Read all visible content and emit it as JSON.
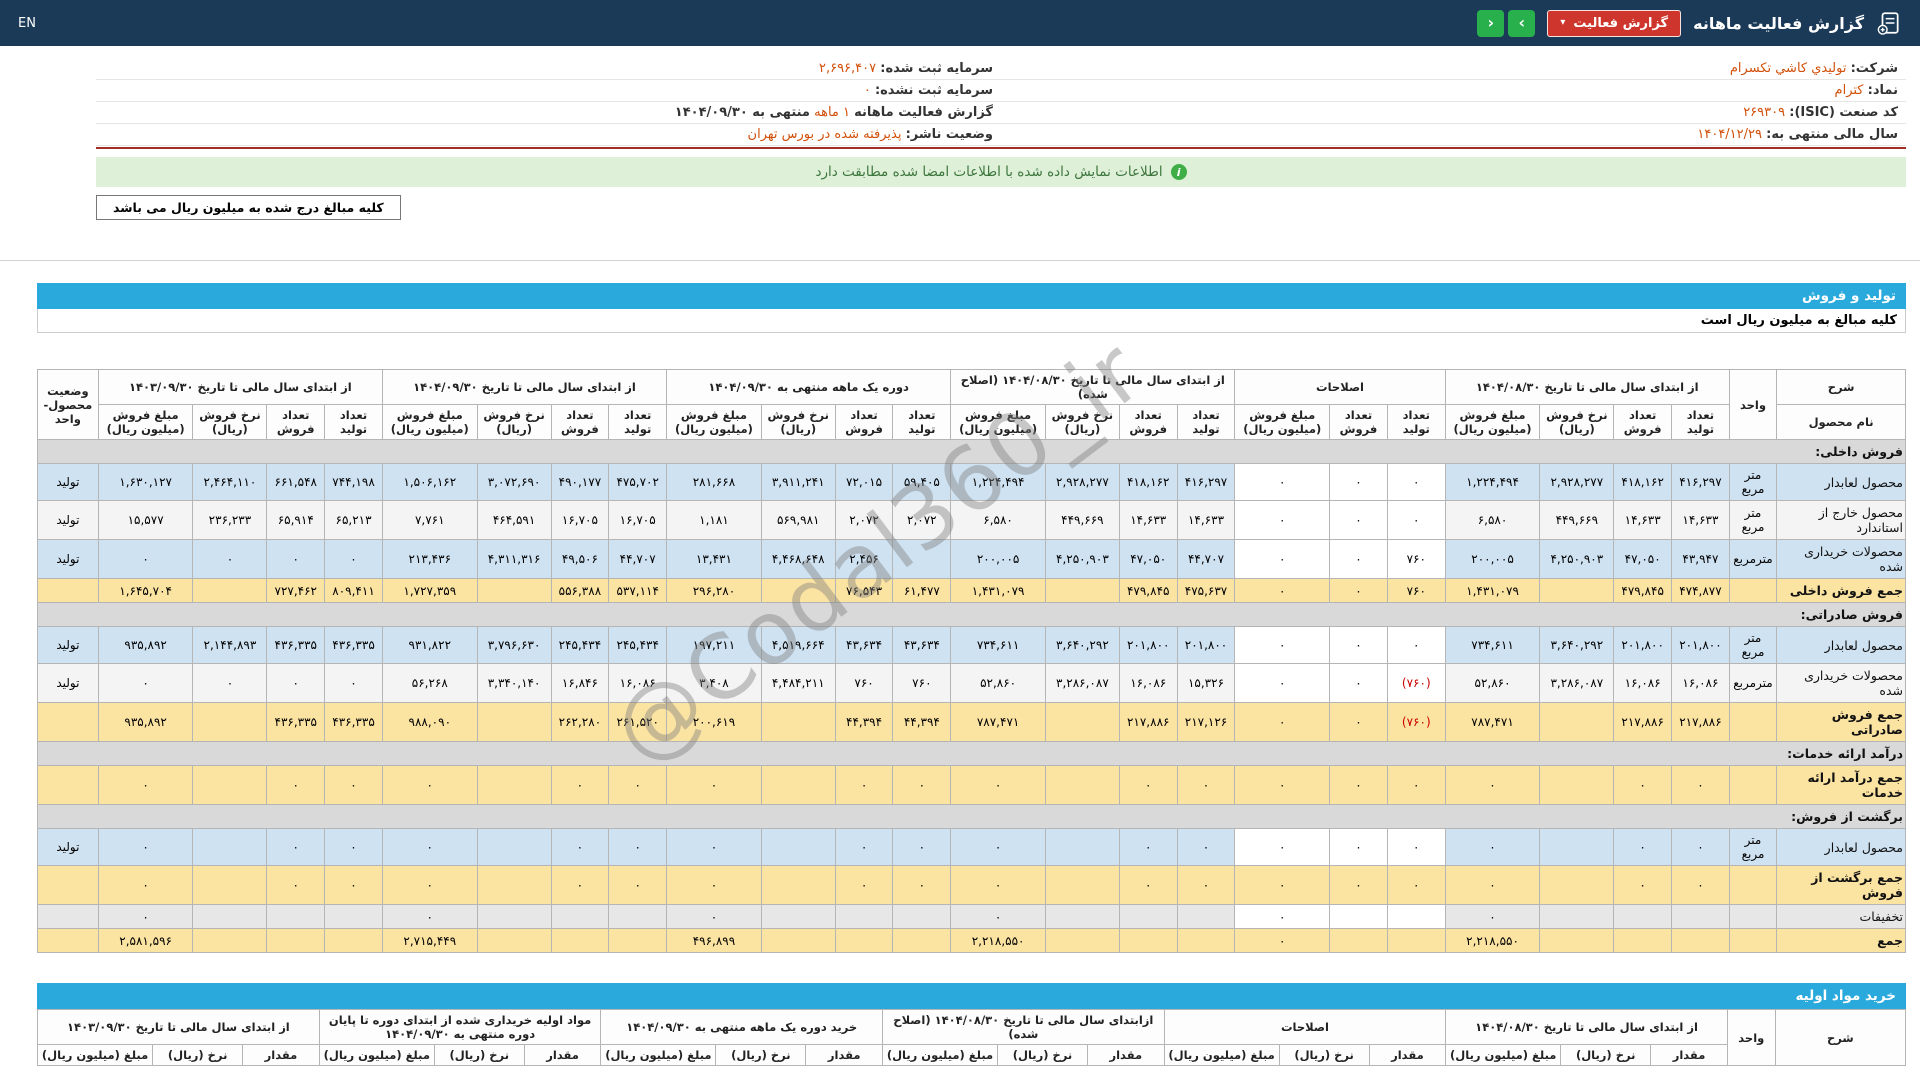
{
  "page": {
    "watermark": "@Codal360_ir",
    "colors": {
      "header_bar": "#1b3a57",
      "accent": "#d2500a",
      "section_bar": "#29a9dc",
      "notice_bg": "#dff0d8",
      "notice_text": "#3c763d",
      "row_blue": "#cfe2f2",
      "row_white": "#f4f4f4",
      "row_gray": "#e7e7e7",
      "row_total": "#fbe3a2",
      "row_section": "#d9d9d9",
      "btn_red": "#ce352c",
      "btn_green": "#28b04c",
      "neg": "#cc0000"
    }
  },
  "header": {
    "title": "گزارش فعالیت ماهانه",
    "report_button_label": "گزارش فعالیت",
    "caret_glyph": "▾",
    "nav_next_glyph": "›",
    "nav_prev_glyph": "‹",
    "lang_label": "EN"
  },
  "info_table": {
    "rows": [
      {
        "right_label": "شرکت:",
        "right_value": "توليدي كاشي تكسرام",
        "right_link": true,
        "left_label": "سرمایه ثبت شده:",
        "left_value": "۲,۶۹۶,۴۰۷",
        "left_suffix": "",
        "left_link": false
      },
      {
        "right_label": "نماد:",
        "right_value": "كترام",
        "right_link": true,
        "left_label": "سرمایه ثبت نشده:",
        "left_value": "۰",
        "left_suffix": "",
        "left_link": false
      },
      {
        "right_label": "کد صنعت (ISIC):",
        "right_value": "۲۶۹۳۰۹",
        "right_link": false,
        "left_label": "گزارش فعالیت ماهانه",
        "left_value": "۱ ماهه",
        "left_suffix": "منتهی به ۱۴۰۴/۰۹/۳۰",
        "left_link": false
      },
      {
        "right_label": "سال مالی منتهی به:",
        "right_value": "۱۴۰۴/۱۲/۲۹",
        "right_link": false,
        "left_label": "وضعیت ناشر:",
        "left_value": "پذيرفته شده در بورس تهران",
        "left_suffix": "",
        "left_link": false
      }
    ]
  },
  "notice": {
    "icon": "i",
    "text": "اطلاعات نمایش داده شده با اطلاعات امضا شده مطابقت دارد"
  },
  "unit_tab": {
    "text": "کلیه مبالغ درج شده به میلیون ریال می باشد"
  },
  "sales_section": {
    "bar_title": "تولید و فروش",
    "note": "کلیه مبالغ به میلیون ریال است"
  },
  "sales_table": {
    "desc_header": "شرح",
    "name_header": "نام محصول",
    "unit_header": "واحد",
    "status_header": "وضعیت محصول-واحد",
    "groups": [
      {
        "label": "از ابتدای سال مالی تا تاریخ ۱۴۰۴/۰۸/۳۰",
        "cols": [
          "تعداد تولید",
          "تعداد فروش",
          "نرخ فروش (ریال)",
          "مبلغ فروش (میلیون ریال)"
        ]
      },
      {
        "label": "اصلاحات",
        "cols": [
          "تعداد تولید",
          "تعداد فروش",
          "مبلغ فروش (میلیون ریال)"
        ]
      },
      {
        "label": "از ابتدای سال مالی تا تاریخ ۱۴۰۴/۰۸/۳۰ (اصلاح شده)",
        "cols": [
          "تعداد تولید",
          "تعداد فروش",
          "نرخ فروش (ریال)",
          "مبلغ فروش (میلیون ریال)"
        ]
      },
      {
        "label": "دوره یک ماهه منتهی به ۱۴۰۴/۰۹/۳۰",
        "cols": [
          "تعداد تولید",
          "تعداد فروش",
          "نرخ فروش (ریال)",
          "مبلغ فروش (میلیون ریال)"
        ]
      },
      {
        "label": "از ابتدای سال مالی تا تاریخ ۱۴۰۴/۰۹/۳۰",
        "cols": [
          "تعداد تولید",
          "تعداد فروش",
          "نرخ فروش (ریال)",
          "مبلغ فروش (میلیون ریال)"
        ]
      },
      {
        "label": "از ابتدای سال مالی تا تاریخ ۱۴۰۳/۰۹/۳۰",
        "cols": [
          "تعداد تولید",
          "تعداد فروش",
          "نرخ فروش (ریال)",
          "مبلغ فروش (میلیون ریال)"
        ]
      }
    ],
    "rows": [
      {
        "type": "section",
        "label": "فروش داخلی:"
      },
      {
        "type": "data",
        "shade": "blue",
        "name": "محصول لعابدار",
        "unit": "متر مربع",
        "status": "تولید",
        "values": [
          "۴۱۶,۲۹۷",
          "۴۱۸,۱۶۲",
          "۲,۹۲۸,۲۷۷",
          "۱,۲۲۴,۴۹۴",
          "۰",
          "۰",
          "۰",
          "۴۱۶,۲۹۷",
          "۴۱۸,۱۶۲",
          "۲,۹۲۸,۲۷۷",
          "۱,۲۲۴,۴۹۴",
          "۵۹,۴۰۵",
          "۷۲,۰۱۵",
          "۳,۹۱۱,۲۴۱",
          "۲۸۱,۶۶۸",
          "۴۷۵,۷۰۲",
          "۴۹۰,۱۷۷",
          "۳,۰۷۲,۶۹۰",
          "۱,۵۰۶,۱۶۲",
          "۷۴۴,۱۹۸",
          "۶۶۱,۵۴۸",
          "۲,۴۶۴,۱۱۰",
          "۱,۶۳۰,۱۲۷"
        ]
      },
      {
        "type": "data",
        "shade": "white",
        "name": "محصول خارج از استاندارد",
        "unit": "متر مربع",
        "status": "تولید",
        "values": [
          "۱۴,۶۳۳",
          "۱۴,۶۳۳",
          "۴۴۹,۶۶۹",
          "۶,۵۸۰",
          "۰",
          "۰",
          "۰",
          "۱۴,۶۳۳",
          "۱۴,۶۳۳",
          "۴۴۹,۶۶۹",
          "۶,۵۸۰",
          "۲,۰۷۲",
          "۲,۰۷۲",
          "۵۶۹,۹۸۱",
          "۱,۱۸۱",
          "۱۶,۷۰۵",
          "۱۶,۷۰۵",
          "۴۶۴,۵۹۱",
          "۷,۷۶۱",
          "۶۵,۲۱۳",
          "۶۵,۹۱۴",
          "۲۳۶,۲۳۳",
          "۱۵,۵۷۷"
        ]
      },
      {
        "type": "data",
        "shade": "blue",
        "name": "محصولات خریداری شده",
        "unit": "مترمربع",
        "status": "تولید",
        "values": [
          "۴۳,۹۴۷",
          "۴۷,۰۵۰",
          "۴,۲۵۰,۹۰۳",
          "۲۰۰,۰۰۵",
          "۷۶۰",
          "۰",
          "۰",
          "۴۴,۷۰۷",
          "۴۷,۰۵۰",
          "۴,۲۵۰,۹۰۳",
          "۲۰۰,۰۰۵",
          "",
          "۲,۴۵۶",
          "۴,۴۶۸,۶۴۸",
          "۱۳,۴۳۱",
          "۴۴,۷۰۷",
          "۴۹,۵۰۶",
          "۴,۳۱۱,۳۱۶",
          "۲۱۳,۴۳۶",
          "۰",
          "۰",
          "۰",
          "۰"
        ]
      },
      {
        "type": "total",
        "name": "جمع فروش داخلی",
        "unit": "",
        "status": "",
        "values": [
          "۴۷۴,۸۷۷",
          "۴۷۹,۸۴۵",
          "",
          "۱,۴۳۱,۰۷۹",
          "۷۶۰",
          "۰",
          "۰",
          "۴۷۵,۶۳۷",
          "۴۷۹,۸۴۵",
          "",
          "۱,۴۳۱,۰۷۹",
          "۶۱,۴۷۷",
          "۷۶,۵۴۳",
          "",
          "۲۹۶,۲۸۰",
          "۵۳۷,۱۱۴",
          "۵۵۶,۳۸۸",
          "",
          "۱,۷۲۷,۳۵۹",
          "۸۰۹,۴۱۱",
          "۷۲۷,۴۶۲",
          "",
          "۱,۶۴۵,۷۰۴"
        ]
      },
      {
        "type": "section",
        "label": "فروش صادراتی:"
      },
      {
        "type": "data",
        "shade": "blue",
        "name": "محصول لعابدار",
        "unit": "متر مربع",
        "status": "تولید",
        "values": [
          "۲۰۱,۸۰۰",
          "۲۰۱,۸۰۰",
          "۳,۶۴۰,۲۹۲",
          "۷۳۴,۶۱۱",
          "۰",
          "۰",
          "۰",
          "۲۰۱,۸۰۰",
          "۲۰۱,۸۰۰",
          "۳,۶۴۰,۲۹۲",
          "۷۳۴,۶۱۱",
          "۴۳,۶۳۴",
          "۴۳,۶۳۴",
          "۴,۵۱۹,۶۶۴",
          "۱۹۷,۲۱۱",
          "۲۴۵,۴۳۴",
          "۲۴۵,۴۳۴",
          "۳,۷۹۶,۶۳۰",
          "۹۳۱,۸۲۲",
          "۴۳۶,۳۳۵",
          "۴۳۶,۳۳۵",
          "۲,۱۴۴,۸۹۳",
          "۹۳۵,۸۹۲"
        ]
      },
      {
        "type": "data",
        "shade": "white",
        "name": "محصولات خریداری شده",
        "unit": "مترمربع",
        "status": "تولید",
        "values": [
          "۱۶,۰۸۶",
          "۱۶,۰۸۶",
          "۳,۲۸۶,۰۸۷",
          "۵۲,۸۶۰",
          "(۷۶۰)",
          "۰",
          "۰",
          "۱۵,۳۲۶",
          "۱۶,۰۸۶",
          "۳,۲۸۶,۰۸۷",
          "۵۲,۸۶۰",
          "۷۶۰",
          "۷۶۰",
          "۴,۴۸۴,۲۱۱",
          "۳,۴۰۸",
          "۱۶,۰۸۶",
          "۱۶,۸۴۶",
          "۳,۳۴۰,۱۴۰",
          "۵۶,۲۶۸",
          "۰",
          "۰",
          "۰",
          "۰"
        ]
      },
      {
        "type": "total",
        "name": "جمع فروش صادراتی",
        "unit": "",
        "status": "",
        "values": [
          "۲۱۷,۸۸۶",
          "۲۱۷,۸۸۶",
          "",
          "۷۸۷,۴۷۱",
          "(۷۶۰)",
          "۰",
          "۰",
          "۲۱۷,۱۲۶",
          "۲۱۷,۸۸۶",
          "",
          "۷۸۷,۴۷۱",
          "۴۴,۳۹۴",
          "۴۴,۳۹۴",
          "",
          "۲۰۰,۶۱۹",
          "۲۶۱,۵۲۰",
          "۲۶۲,۲۸۰",
          "",
          "۹۸۸,۰۹۰",
          "۴۳۶,۳۳۵",
          "۴۳۶,۳۳۵",
          "",
          "۹۳۵,۸۹۲"
        ]
      },
      {
        "type": "section",
        "label": "درآمد ارائه خدمات:"
      },
      {
        "type": "total",
        "name": "جمع درآمد ارائه خدمات",
        "unit": "",
        "status": "",
        "values": [
          "۰",
          "۰",
          "",
          "۰",
          "۰",
          "۰",
          "۰",
          "۰",
          "۰",
          "",
          "۰",
          "۰",
          "۰",
          "",
          "۰",
          "۰",
          "۰",
          "",
          "۰",
          "۰",
          "۰",
          "",
          "۰"
        ]
      },
      {
        "type": "section",
        "label": "برگشت از فروش:"
      },
      {
        "type": "data",
        "shade": "blue",
        "name": "محصول لعابدار",
        "unit": "متر مربع",
        "status": "تولید",
        "values": [
          "۰",
          "۰",
          "",
          "۰",
          "۰",
          "۰",
          "۰",
          "۰",
          "۰",
          "",
          "۰",
          "۰",
          "۰",
          "",
          "۰",
          "۰",
          "۰",
          "",
          "۰",
          "۰",
          "۰",
          "",
          "۰"
        ]
      },
      {
        "type": "total",
        "name": "جمع برگشت از فروش",
        "unit": "",
        "status": "",
        "values": [
          "۰",
          "۰",
          "",
          "۰",
          "۰",
          "۰",
          "۰",
          "۰",
          "۰",
          "",
          "۰",
          "۰",
          "۰",
          "",
          "۰",
          "۰",
          "۰",
          "",
          "۰",
          "۰",
          "۰",
          "",
          "۰"
        ]
      },
      {
        "type": "data",
        "shade": "gray",
        "name": "تخفیفات",
        "unit": "",
        "status": "",
        "values": [
          "",
          "",
          "",
          "۰",
          "",
          "",
          "۰",
          "",
          "",
          "",
          "۰",
          "",
          "",
          "",
          "۰",
          "",
          "",
          "",
          "۰",
          "",
          "",
          "",
          "۰"
        ]
      },
      {
        "type": "total",
        "name": "جمع",
        "unit": "",
        "status": "",
        "values": [
          "",
          "",
          "",
          "۲,۲۱۸,۵۵۰",
          "",
          "",
          "۰",
          "",
          "",
          "",
          "۲,۲۱۸,۵۵۰",
          "",
          "",
          "",
          "۴۹۶,۸۹۹",
          "",
          "",
          "",
          "۲,۷۱۵,۴۴۹",
          "",
          "",
          "",
          "۲,۵۸۱,۵۹۶"
        ]
      }
    ]
  },
  "purchase_section": {
    "bar_title": "خرید مواد اولیه",
    "desc_header": "شرح",
    "unit_header": "واحد",
    "groups": [
      {
        "label": "از ابتدای سال مالی تا تاریخ ۱۴۰۴/۰۸/۳۰"
      },
      {
        "label": "اصلاحات"
      },
      {
        "label": "ازابتدای سال مالی تا تاریخ ۱۴۰۴/۰۸/۳۰ (اصلاح شده)"
      },
      {
        "label": "خرید دوره یک ماهه منتهی به ۱۴۰۴/۰۹/۳۰"
      },
      {
        "label": "مواد اولیه خریداری شده از ابتدای دوره تا پایان دوره منتهی به ۱۴۰۴/۰۹/۳۰"
      },
      {
        "label": "از ابتدای سال مالی تا تاریخ ۱۴۰۳/۰۹/۳۰"
      }
    ],
    "subcols": [
      "مقدار",
      "نرخ (ریال)",
      "مبلغ (میلیون ریال)"
    ]
  }
}
